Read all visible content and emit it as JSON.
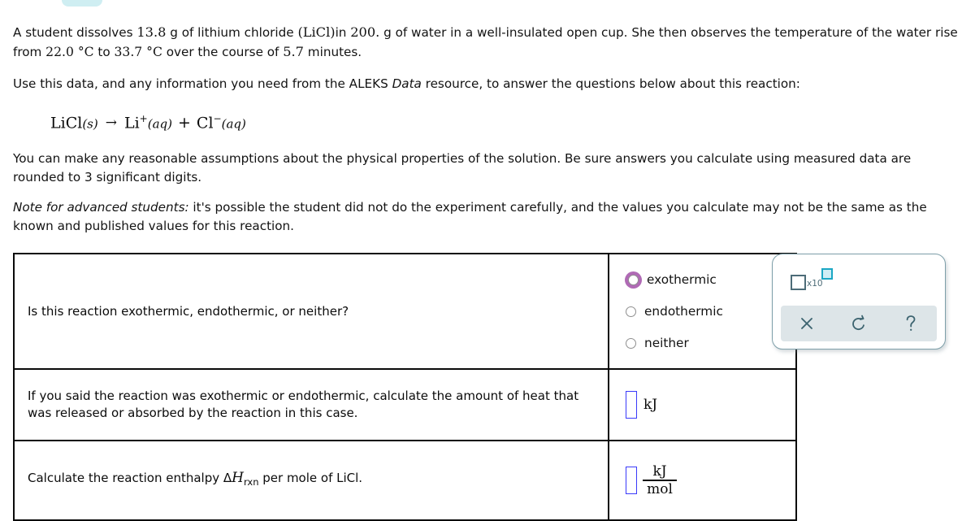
{
  "problem": {
    "p1_a": "A student dissolves ",
    "p1_mass": "13.8",
    "p1_b": " g of lithium chloride ",
    "p1_formula": "(LiCl)",
    "p1_c": "in ",
    "p1_water": "200.",
    "p1_d": " g of water in a well-insulated open cup. She then observes the temperature of the water rise from ",
    "p1_t1": "22.0 °C",
    "p1_e": " to ",
    "p1_t2": "33.7 °C",
    "p1_f": " over the course of ",
    "p1_time": "5.7",
    "p1_g": " minutes.",
    "p2_a": "Use this data, and any information you need from the ALEKS ",
    "p2_italic": "Data",
    "p2_b": " resource, to answer the questions below about this reaction:",
    "p3": "You can make any reasonable assumptions about the physical properties of the solution. Be sure answers you calculate using measured data are rounded to 3 significant digits.",
    "p4_italic": "Note for advanced students:",
    "p4_rest": " it's possible the student did not do the experiment carefully, and the values you calculate may not be the same as the known and published values for this reaction."
  },
  "equation": {
    "reactant": "LiCl",
    "reactant_state": "(s)",
    "arrow": "→",
    "product1": "Li",
    "product1_charge": "+",
    "product1_state": "(aq)",
    "plus": "+",
    "product2": "Cl",
    "product2_charge": "−",
    "product2_state": "(aq)"
  },
  "table": {
    "rows": [
      {
        "question": "Is this reaction exothermic, endothermic, or neither?",
        "answer_type": "radio",
        "options": [
          {
            "label": "exothermic",
            "focused": true,
            "selected": false
          },
          {
            "label": "endothermic",
            "focused": false,
            "selected": false
          },
          {
            "label": "neither",
            "focused": false,
            "selected": false
          }
        ]
      },
      {
        "question": "If you said the reaction was exothermic or endothermic, calculate the amount of heat that was released or absorbed by the reaction in this case.",
        "answer_type": "input-unit",
        "input_value": "",
        "unit": "kJ"
      },
      {
        "question_a": "Calculate the reaction enthalpy Δ",
        "question_symbol": "H",
        "question_sub": "rxn",
        "question_b": " per mole of LiCl.",
        "answer_type": "input-fraction",
        "input_value": "",
        "unit_numerator": "kJ",
        "unit_denominator": "mol"
      }
    ]
  },
  "toolbar": {
    "scientific_notation_label": "x10",
    "buttons": [
      {
        "name": "clear",
        "glyph": "×"
      },
      {
        "name": "undo",
        "glyph": "↺"
      },
      {
        "name": "help",
        "glyph": "?"
      }
    ]
  },
  "colors": {
    "radio_focus_ring": "#b06ab5",
    "input_border": "#3a3afa",
    "panel_border": "#7e9fa9",
    "toolbar_bar": "#dde5e8",
    "toolbar_icon": "#3d6470",
    "exp_box_border": "#1ba7c4",
    "exp_box_fill": "#cfeef5",
    "tab_fragment": "#cfeef2"
  }
}
